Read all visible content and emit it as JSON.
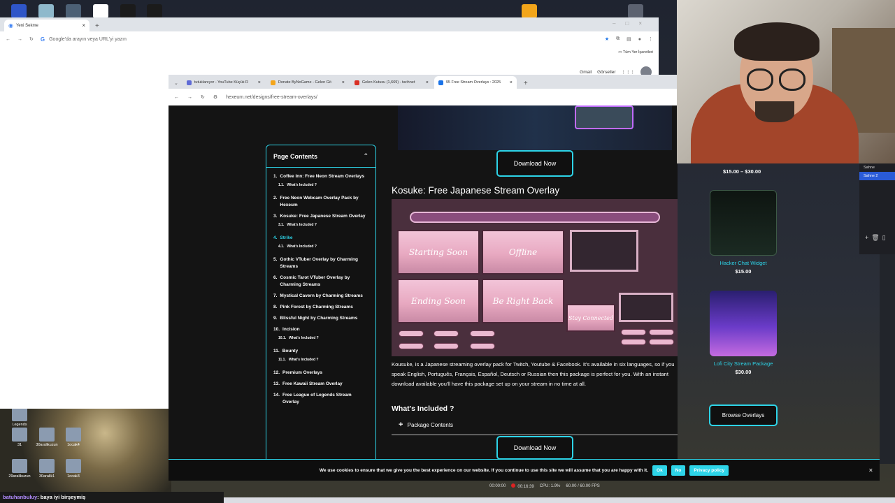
{
  "desktop": {
    "top_icons": [
      "#2f56c8",
      "#8fb9cc",
      "#4c6075",
      "#ffffff",
      "#1b1b1b",
      "#1b1b1b",
      "#f2a51a",
      "#5c6270"
    ],
    "icons": [
      {
        "label": "Legends"
      },
      {
        "label": "31"
      },
      {
        "label": "30aralikuzun"
      },
      {
        "label": "1ocak4"
      },
      {
        "label": "29aralikuzun"
      },
      {
        "label": "30aralik1"
      },
      {
        "label": "1ocak3"
      }
    ]
  },
  "window1": {
    "tab_title": "Yeni Sekme",
    "omnibox_placeholder": "Google'da arayın veya URL'yi yazın",
    "bookmarks_label": "Tüm Yer İşaretleri",
    "links": [
      "Gmail",
      "Görseller"
    ]
  },
  "window2": {
    "tabs": [
      {
        "title": "tutuklanıyor - YouTube Küçük R",
        "color": "#5f6bd6"
      },
      {
        "title": "Donate ByNoGame - Gelen Gö",
        "color": "#f4a51b"
      },
      {
        "title": "Gelen Kutusu (1,669) - tarihnet",
        "color": "#d93025"
      },
      {
        "title": "95 Free Stream Overlays : 2025",
        "color": "#1a73e8"
      }
    ],
    "url": "hexeum.net/designs/free-stream-overlays/"
  },
  "page": {
    "toc_title": "Page Contents",
    "toc": [
      {
        "n": "1.",
        "label": "Coffee Inn: Free Neon Stream Overlays",
        "sub": {
          "n": "1.1.",
          "label": "What's Included ?"
        }
      },
      {
        "n": "2.",
        "label": "Free Neon Webcam Overlay Pack by Hexeum"
      },
      {
        "n": "3.",
        "label": "Kosuke: Free Japanese Stream Overlay",
        "sub": {
          "n": "3.1.",
          "label": "What's Included ?"
        }
      },
      {
        "n": "4.",
        "label": "Strike",
        "active": true,
        "sub": {
          "n": "4.1.",
          "label": "What's Included ?"
        }
      },
      {
        "n": "5.",
        "label": "Gothic VTuber Overlay by Charming Streams"
      },
      {
        "n": "6.",
        "label": "Cosmic Tarot VTuber Overlay by Charming Streams"
      },
      {
        "n": "7.",
        "label": "Mystical Cavern by Charming Streams"
      },
      {
        "n": "8.",
        "label": "Pink Forest by Charming Streams"
      },
      {
        "n": "9.",
        "label": "Blissful Night by Charming Streams"
      },
      {
        "n": "10.",
        "label": "Incision",
        "sub": {
          "n": "10.1.",
          "label": "What's Included ?"
        }
      },
      {
        "n": "11.",
        "label": "Bounty",
        "sub": {
          "n": "11.1.",
          "label": "What's Included ?"
        }
      },
      {
        "n": "12.",
        "label": "Premium Overlays"
      },
      {
        "n": "13.",
        "label": "Free Kawaii Stream Overlay"
      },
      {
        "n": "14.",
        "label": "Free League of Legends Stream Overlay"
      }
    ],
    "download_label": "Download Now",
    "section_title": "Kosuke: Free Japanese Stream Overlay",
    "overlay_panels": [
      "Starting Soon",
      "Offline",
      "Ending Soon",
      "Be Right Back",
      "Stay Connected"
    ],
    "description": "Kousuke, is a Japanese streaming overlay pack for Twitch, Youtube & Facebook. It's available in six languages, so if you speak English, Português, Français, Español, Deutsch or Russian then this package is perfect for you. With an instant download available you'll have this package set up on your stream in no time at all.",
    "whats_included": "What's Included ?",
    "package_contents": "Package Contents",
    "sidebar": {
      "top_price": "$15.00 – $30.00",
      "products": [
        {
          "name": "Hacker Chat Widget",
          "price": "$15.00"
        },
        {
          "name": "Lofi City Stream Package",
          "price": "$30.00"
        }
      ],
      "browse_label": "Browse Overlays"
    },
    "cookie": {
      "text": "We use cookies to ensure that we give you the best experience on our website. If you continue to use this site we will assume that you are happy with it.",
      "ok": "Ok",
      "no": "No",
      "privacy": "Privacy policy"
    }
  },
  "obs": {
    "scenes": [
      "Sahne",
      "Sahne 2"
    ]
  },
  "status": {
    "t1": "00:00:00",
    "t2": "00:16:39",
    "cpu": "CPU: 1.9%",
    "fps": "60.00 / 60.00 FPS"
  },
  "chat": {
    "user": "batuhanbuluy",
    "sep": ": ",
    "message": "baya iyi birşeymiş"
  },
  "colors": {
    "accent": "#2dd4e8",
    "page_bg": "#141414"
  }
}
